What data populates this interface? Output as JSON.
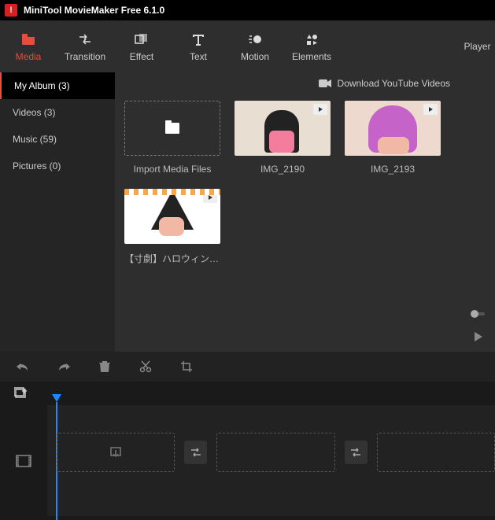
{
  "title": "MiniTool MovieMaker Free 6.1.0",
  "toolbar": {
    "media": "Media",
    "transition": "Transition",
    "effect": "Effect",
    "text": "Text",
    "motion": "Motion",
    "elements": "Elements"
  },
  "player_label": "Player",
  "sidebar": {
    "items": [
      {
        "label": "My Album (3)"
      },
      {
        "label": "Videos (3)"
      },
      {
        "label": "Music (59)"
      },
      {
        "label": "Pictures (0)"
      }
    ]
  },
  "download_yt": "Download YouTube Videos",
  "media": {
    "import_label": "Import Media Files",
    "items": [
      {
        "name": "IMG_2190"
      },
      {
        "name": "IMG_2193"
      },
      {
        "name": "【寸劇】ハロウィンでちー..."
      }
    ]
  }
}
